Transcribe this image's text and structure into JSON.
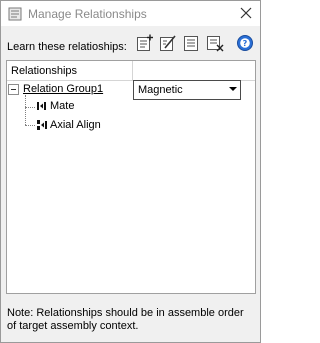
{
  "window": {
    "title": "Manage Relationships",
    "icon": "relationships-app-icon",
    "close_icon": "close-icon"
  },
  "toolbar": {
    "learn_label": "Learn these relatioships:",
    "buttons": [
      {
        "icon": "add-list-icon"
      },
      {
        "icon": "edit-list-icon"
      },
      {
        "icon": "list-icon"
      },
      {
        "icon": "remove-list-icon"
      },
      {
        "icon": "help-icon"
      }
    ]
  },
  "tree": {
    "column_header": "Relationships",
    "group": {
      "label": "Relation Group1",
      "expanded": true,
      "mode": "Magnetic",
      "children": [
        {
          "label": "Mate",
          "icon": "mate-icon"
        },
        {
          "label": "Axial Align",
          "icon": "axial-align-icon"
        }
      ]
    }
  },
  "note": "Note: Relationships should be in assemble order of target assembly context.",
  "colors": {
    "accent_blue": "#1f5fbf",
    "help_blue": "#2a6fd6",
    "panel_bg": "#f0f0f0"
  }
}
